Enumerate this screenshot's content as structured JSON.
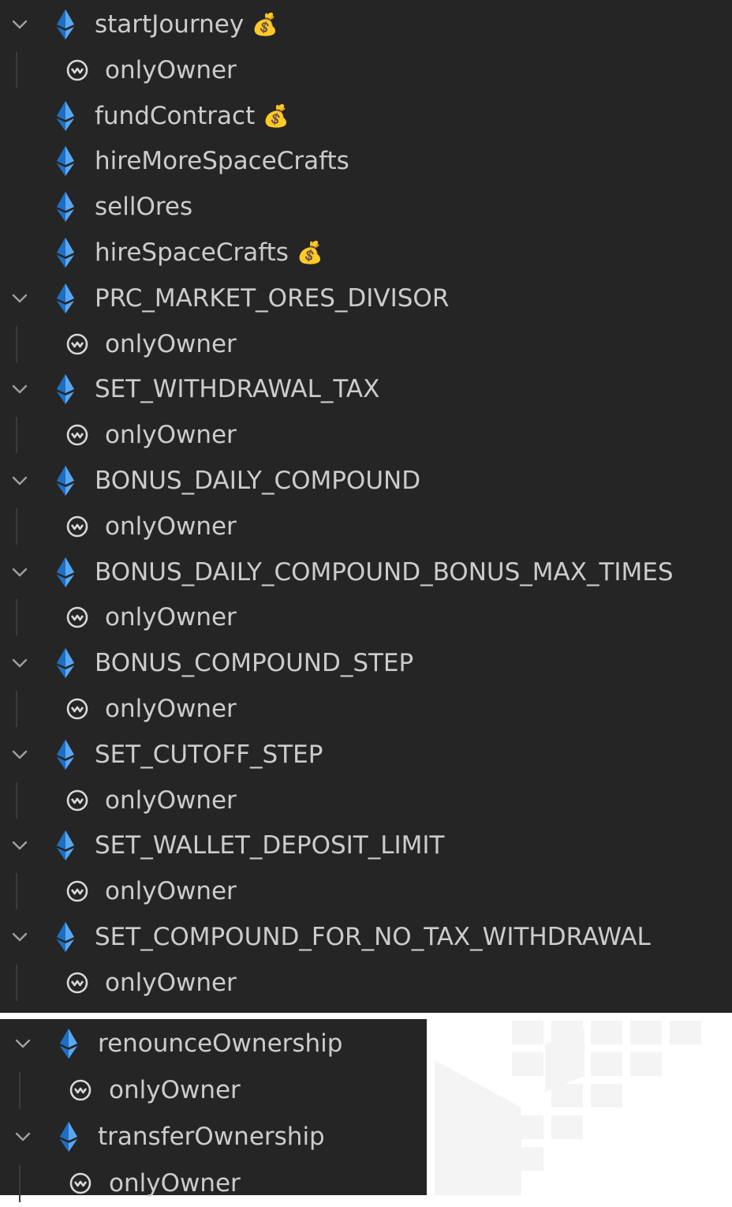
{
  "colors": {
    "panel_bg": "#252526",
    "text": "#cccccc",
    "eth_blue_light": "#5aa7ef",
    "eth_blue_dark": "#1b6fc4",
    "chevron": "#a0a0a0",
    "guide_line": "#3c3c3c"
  },
  "icons": {
    "function": "ethereum-diamond-icon",
    "modifier": "modifier-face-icon",
    "payable": "money-bag-icon",
    "expand": "chevron-down-icon",
    "money_bag_glyph": "💰"
  },
  "tree_top": [
    {
      "name": "startJourney",
      "payable": true,
      "expanded": true,
      "modifier": "onlyOwner"
    },
    {
      "name": "fundContract",
      "payable": true,
      "expanded": false
    },
    {
      "name": "hireMoreSpaceCrafts",
      "payable": false,
      "expanded": false
    },
    {
      "name": "sellOres",
      "payable": false,
      "expanded": false
    },
    {
      "name": "hireSpaceCrafts",
      "payable": true,
      "expanded": false
    },
    {
      "name": "PRC_MARKET_ORES_DIVISOR",
      "payable": false,
      "expanded": true,
      "modifier": "onlyOwner"
    },
    {
      "name": "SET_WITHDRAWAL_TAX",
      "payable": false,
      "expanded": true,
      "modifier": "onlyOwner"
    },
    {
      "name": "BONUS_DAILY_COMPOUND",
      "payable": false,
      "expanded": true,
      "modifier": "onlyOwner"
    },
    {
      "name": "BONUS_DAILY_COMPOUND_BONUS_MAX_TIMES",
      "payable": false,
      "expanded": true,
      "modifier": "onlyOwner"
    },
    {
      "name": "BONUS_COMPOUND_STEP",
      "payable": false,
      "expanded": true,
      "modifier": "onlyOwner"
    },
    {
      "name": "SET_CUTOFF_STEP",
      "payable": false,
      "expanded": true,
      "modifier": "onlyOwner"
    },
    {
      "name": "SET_WALLET_DEPOSIT_LIMIT",
      "payable": false,
      "expanded": true,
      "modifier": "onlyOwner"
    },
    {
      "name": "SET_COMPOUND_FOR_NO_TAX_WITHDRAWAL",
      "payable": false,
      "expanded": true,
      "modifier": "onlyOwner"
    }
  ],
  "tree_bottom": [
    {
      "name": "renounceOwnership",
      "payable": false,
      "expanded": true,
      "modifier": "onlyOwner"
    },
    {
      "name": "transferOwnership",
      "payable": false,
      "expanded": true,
      "modifier": "onlyOwner"
    }
  ]
}
